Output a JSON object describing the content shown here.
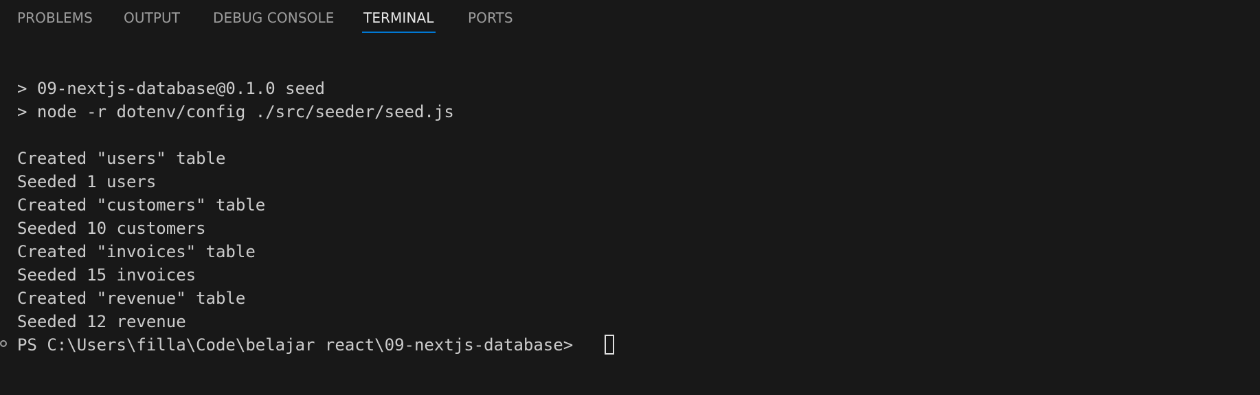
{
  "tabs": [
    {
      "label": "PROBLEMS",
      "active": false
    },
    {
      "label": "OUTPUT",
      "active": false
    },
    {
      "label": "DEBUG CONSOLE",
      "active": false
    },
    {
      "label": "TERMINAL",
      "active": true
    },
    {
      "label": "PORTS",
      "active": false
    }
  ],
  "terminal": {
    "lines": [
      "> 09-nextjs-database@0.1.0 seed",
      "> node -r dotenv/config ./src/seeder/seed.js",
      "",
      "Created \"users\" table",
      "Seeded 1 users",
      "Created \"customers\" table",
      "Seeded 10 customers",
      "Created \"invoices\" table",
      "Seeded 15 invoices",
      "Created \"revenue\" table",
      "Seeded 12 revenue"
    ],
    "prompt": "PS C:\\Users\\filla\\Code\\belajar react\\09-nextjs-database> "
  },
  "colors": {
    "background": "#181818",
    "text": "#cccccc",
    "tab_inactive": "#9d9d9d",
    "tab_active": "#e7e7e7",
    "tab_underline": "#0078d4"
  },
  "icons": {
    "command_decoration": "circle-outline-icon",
    "cursor": "block-cursor"
  }
}
